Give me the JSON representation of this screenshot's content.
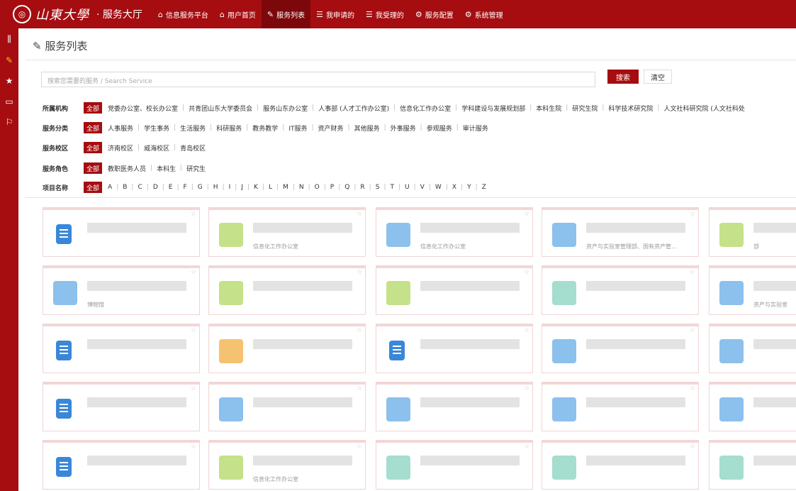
{
  "brand": {
    "logo_text": "山東大學",
    "hall_title": "· 服务大厅"
  },
  "nav": [
    {
      "icon": "home-icon",
      "label": "信息服务平台",
      "active": false
    },
    {
      "icon": "home-icon",
      "label": "用户首页",
      "active": false
    },
    {
      "icon": "edit-icon",
      "label": "服务列表",
      "active": true
    },
    {
      "icon": "list-icon",
      "label": "我申请的",
      "active": false
    },
    {
      "icon": "list-icon",
      "label": "我受理的",
      "active": false
    },
    {
      "icon": "gears-icon",
      "label": "服务配置",
      "active": false
    },
    {
      "icon": "gear-icon",
      "label": "系统管理",
      "active": false
    }
  ],
  "page": {
    "title": "服务列表"
  },
  "search": {
    "placeholder": "搜索您需要的服务 / Search Service",
    "search_label": "搜索",
    "clear_label": "清空"
  },
  "filters": [
    {
      "label": "所属机构",
      "all": "全部",
      "options": [
        "党委办公室、校长办公室",
        "共青团山东大学委员会",
        "服务山东办公室",
        "人事部 (人才工作办公室)",
        "信息化工作办公室",
        "学科建设与发展规划部",
        "本科生院",
        "研究生院",
        "科学技术研究院",
        "人文社科研究院 (人文社科处"
      ]
    },
    {
      "label": "服务分类",
      "all": "全部",
      "options": [
        "人事服务",
        "学生事务",
        "生活服务",
        "科研服务",
        "教务教学",
        "IT服务",
        "资产财务",
        "其他服务",
        "外事服务",
        "参观服务",
        "审计服务"
      ]
    },
    {
      "label": "服务校区",
      "all": "全部",
      "options": [
        "济南校区",
        "威海校区",
        "青岛校区"
      ]
    },
    {
      "label": "服务角色",
      "all": "全部",
      "options": [
        "教职医务人员",
        "本科生",
        "研究生"
      ]
    },
    {
      "label": "项目名称",
      "all": "全部",
      "options": [
        "A",
        "B",
        "C",
        "D",
        "E",
        "F",
        "G",
        "H",
        "I",
        "J",
        "K",
        "L",
        "M",
        "N",
        "O",
        "P",
        "Q",
        "R",
        "S",
        "T",
        "U",
        "V",
        "W",
        "X",
        "Y",
        "Z"
      ]
    }
  ],
  "cards": [
    {
      "icon": "doc",
      "dept": ""
    },
    {
      "icon": "green",
      "dept": "信息化工作办公室"
    },
    {
      "icon": "blue",
      "dept": "信息化工作办公室"
    },
    {
      "icon": "blue",
      "dept": "资产与实验室管理部、国有资产管..."
    },
    {
      "icon": "green",
      "dept": "部"
    },
    {
      "icon": "blue",
      "dept": "博物馆"
    },
    {
      "icon": "green",
      "dept": ""
    },
    {
      "icon": "green",
      "dept": ""
    },
    {
      "icon": "teal",
      "dept": ""
    },
    {
      "icon": "blue",
      "dept": "资产与实验室"
    },
    {
      "icon": "doc",
      "dept": ""
    },
    {
      "icon": "orange",
      "dept": ""
    },
    {
      "icon": "doc",
      "dept": ""
    },
    {
      "icon": "blue",
      "dept": ""
    },
    {
      "icon": "blue",
      "dept": ""
    },
    {
      "icon": "doc",
      "dept": ""
    },
    {
      "icon": "blue",
      "dept": ""
    },
    {
      "icon": "blue",
      "dept": ""
    },
    {
      "icon": "blue",
      "dept": ""
    },
    {
      "icon": "blue",
      "dept": ""
    },
    {
      "icon": "doc",
      "dept": ""
    },
    {
      "icon": "green",
      "dept": "信息化工作办公室"
    },
    {
      "icon": "teal",
      "dept": ""
    },
    {
      "icon": "teal",
      "dept": ""
    },
    {
      "icon": "teal",
      "dept": ""
    }
  ]
}
